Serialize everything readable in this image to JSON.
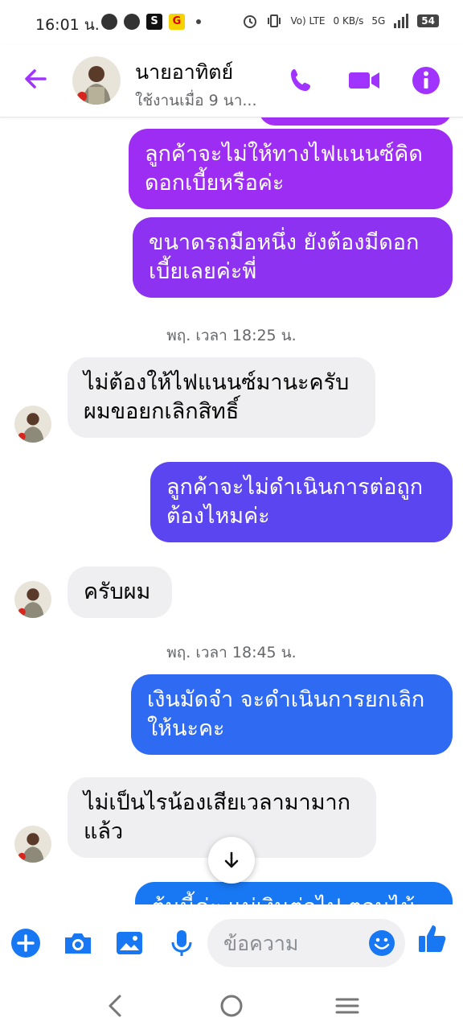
{
  "status_bar": {
    "time": "16:01 น.",
    "app_badge_s": "S",
    "app_badge_g": "G",
    "network_vo": "Vo) LTE",
    "speed": "0 KB/s",
    "network": "5G",
    "battery": "54"
  },
  "header": {
    "contact_name": "นายอาทิตย์",
    "activity_status": "ใช้งานเมื่อ 9 นา..."
  },
  "messages": [
    {
      "side": "out",
      "text": "ลูกค้าจะไม่ให้ทางไฟแนนซ์คิดดอกเบี้ยหรือค่ะ"
    },
    {
      "side": "out",
      "text": "ขนาดรถมือหนึ่ง ยังต้องมีดอกเบี้ยเลยค่ะพี่"
    },
    {
      "side": "timestamp",
      "text": "พฤ. เวลา 18:25 น."
    },
    {
      "side": "in",
      "text": "ไม่ต้องให้ไฟแนนซ์มานะครับผมขอยกเลิกสิทธิ์"
    },
    {
      "side": "out",
      "text": "ลูกค้าจะไม่ดำเนินการต่อถูกต้องไหมค่ะ"
    },
    {
      "side": "in",
      "text": "ครับผม"
    },
    {
      "side": "timestamp",
      "text": "พฤ. เวลา 18:45 น."
    },
    {
      "side": "out",
      "text": "เงินมัดจำ จะดำเนินการยกเลิกให้นะคะ"
    },
    {
      "side": "in",
      "text": "ไม่เป็นไรน้องเสียเวลามามากแล้ว"
    },
    {
      "side": "out",
      "text": "ต้นนี้ค่ะ แม่เงินต่อไป ตอนไม้"
    }
  ],
  "composer": {
    "placeholder": "ข้อความ"
  },
  "colors": {
    "accent": "#a033ff",
    "bubble_purple": "#9b2cf0",
    "bubble_violet": "#6a3cf2",
    "bubble_blue": "#1877f2",
    "incoming_bg": "#efeff1"
  }
}
